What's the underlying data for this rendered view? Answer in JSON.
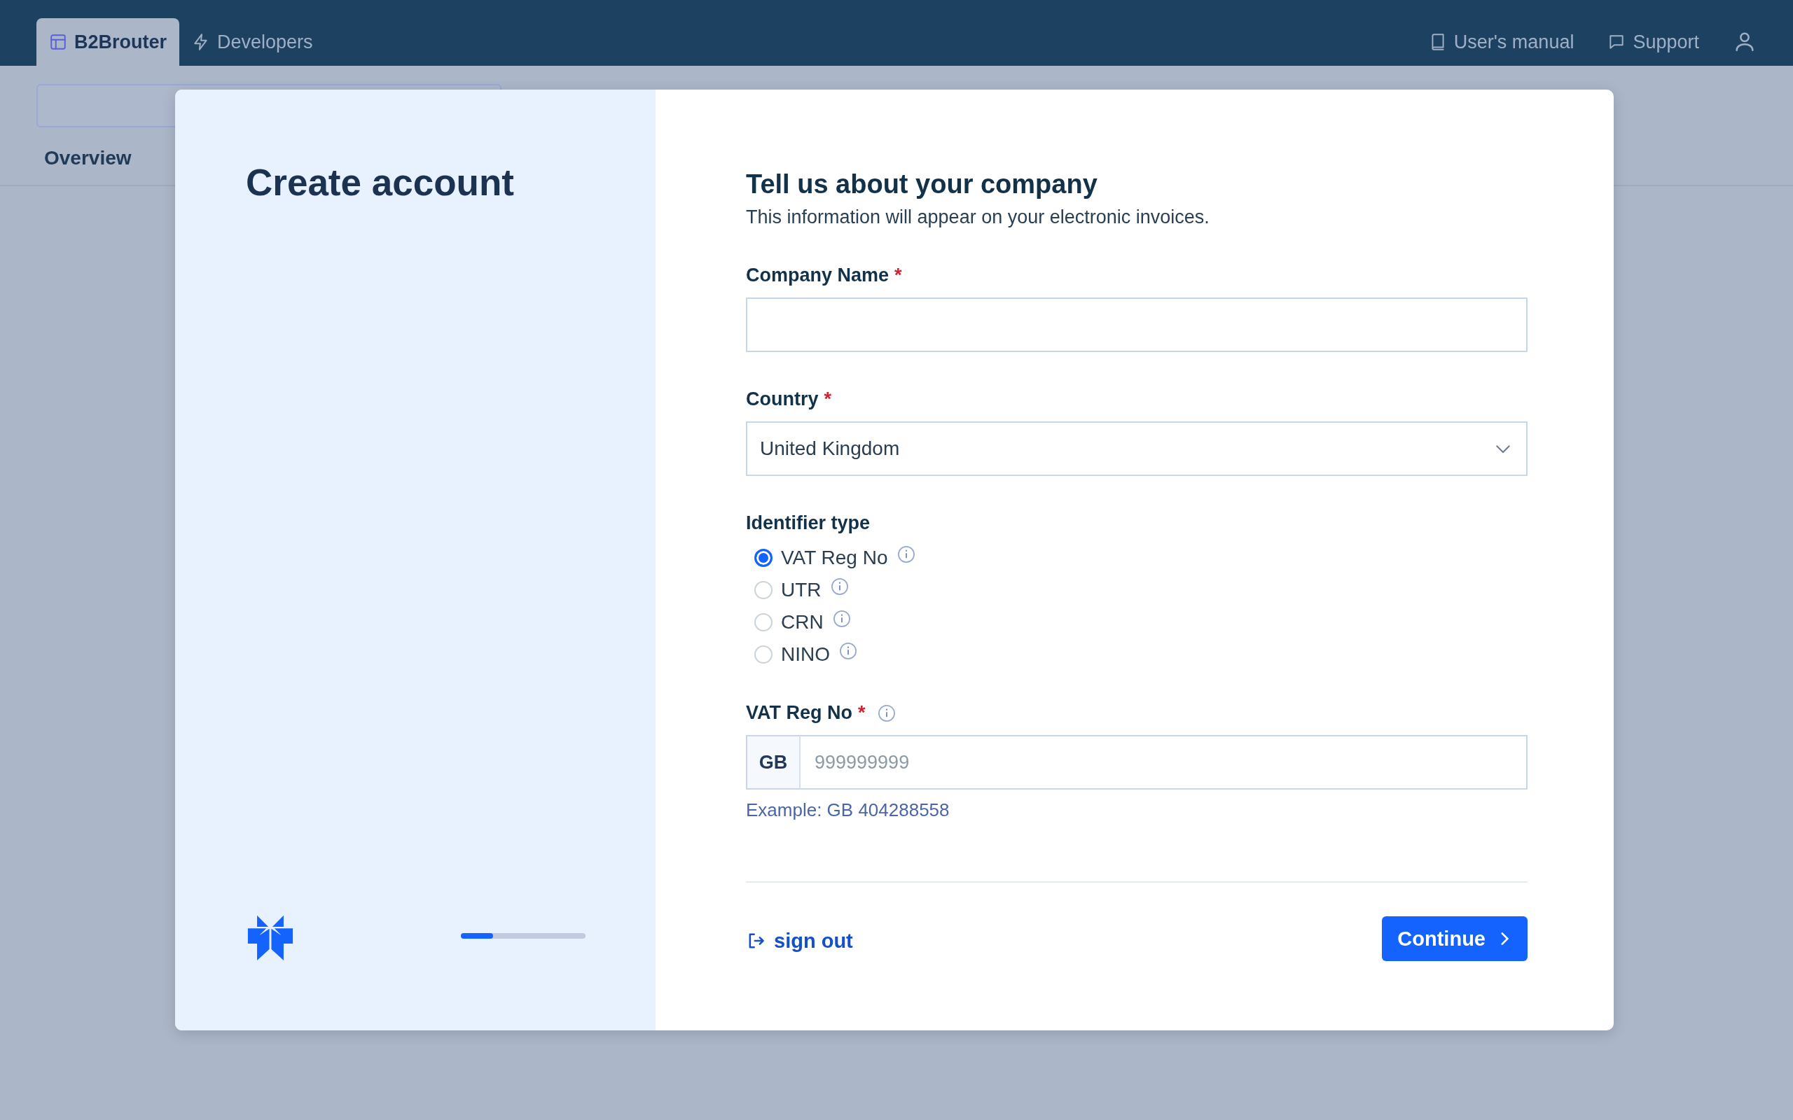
{
  "nav": {
    "tabs": [
      {
        "label": "B2Brouter",
        "selected": true
      },
      {
        "label": "Developers",
        "selected": false
      }
    ],
    "links": [
      {
        "kind": "manual",
        "label": "User's manual"
      },
      {
        "kind": "support",
        "label": "Support"
      }
    ]
  },
  "background_tabs": [
    {
      "label": "Overview"
    }
  ],
  "modal": {
    "title": "Create account",
    "progress": {
      "level": 0.26
    },
    "heading": "Tell us about your company",
    "subheading": "This information will appear on your electronic invoices.",
    "fields": [
      {
        "kind": "text",
        "label": "Company Name",
        "required_mark": "*"
      },
      {
        "kind": "select",
        "label": "Country",
        "required_mark": "*",
        "value": "United Kingdom"
      },
      {
        "kind": "radio",
        "label": "Identifier type",
        "options": [
          {
            "label": "VAT Reg No",
            "selected": true
          },
          {
            "label": "UTR",
            "selected": false
          },
          {
            "label": "CRN",
            "selected": false
          },
          {
            "label": "NINO",
            "selected": false
          }
        ]
      },
      {
        "kind": "prefixed",
        "label": "VAT Reg No",
        "required_mark": "*",
        "info": true,
        "prefix": "GB",
        "placeholder": "999999999",
        "help": "Example: GB 404288558"
      }
    ],
    "sign_out": "sign out",
    "continue": "Continue"
  }
}
